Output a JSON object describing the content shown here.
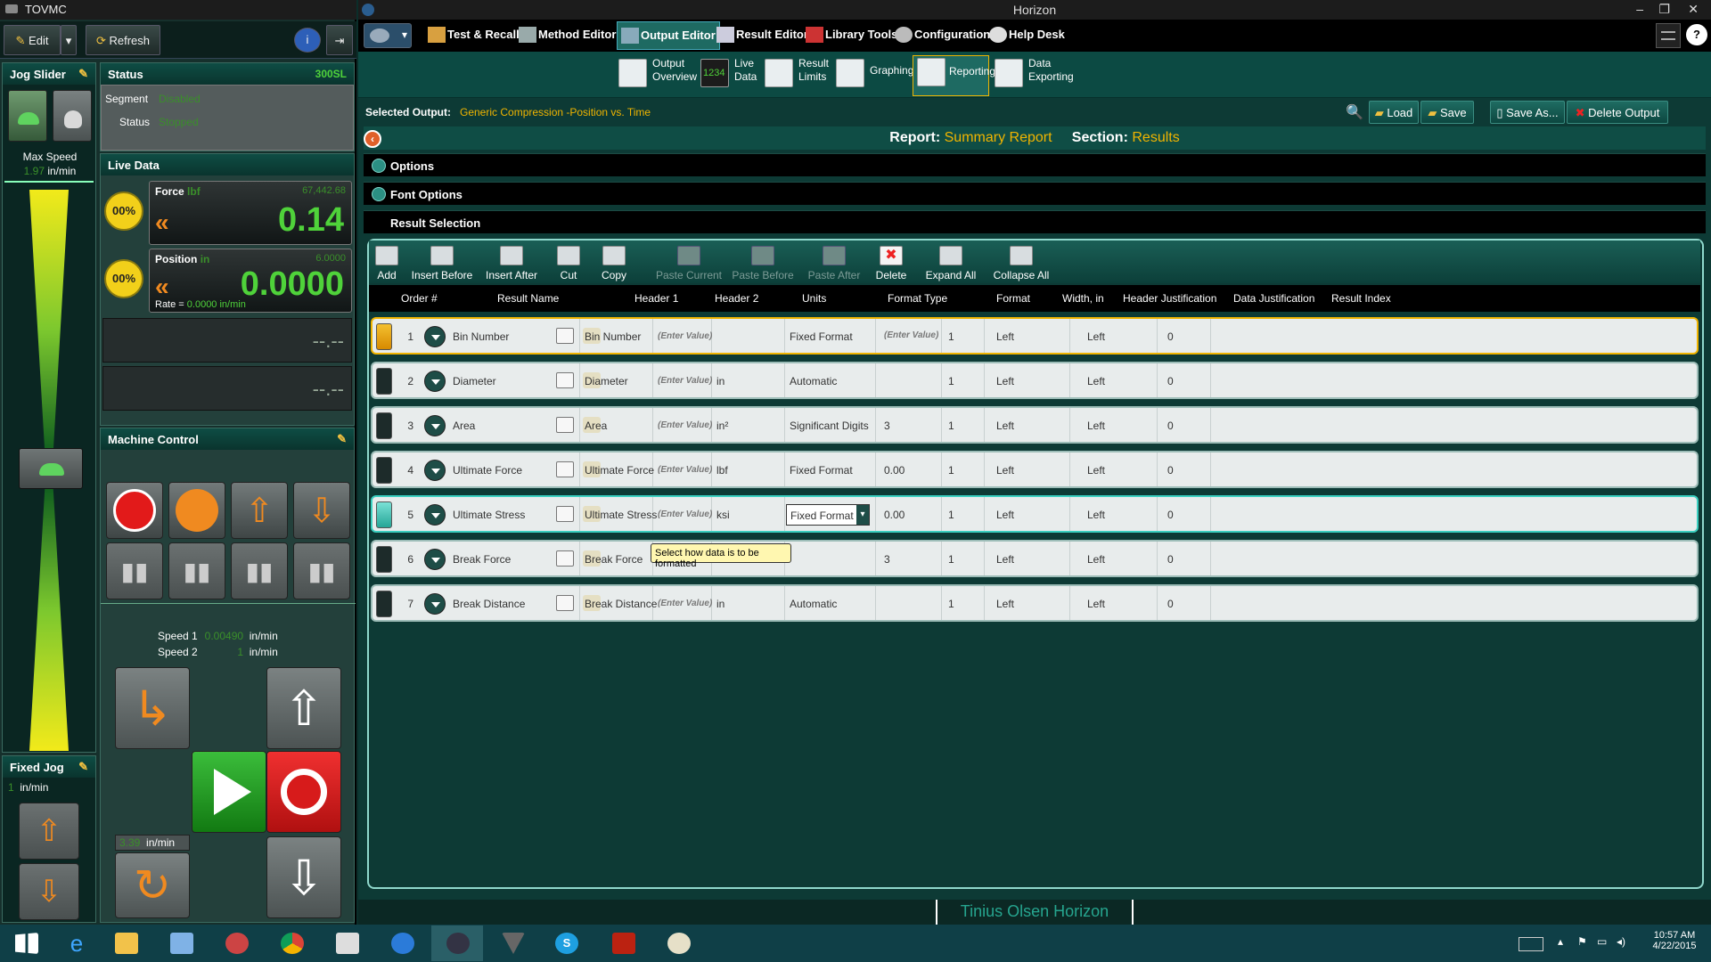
{
  "tovmc": {
    "title": "TOVMC",
    "toolbar": {
      "edit": "Edit",
      "refresh": "Refresh"
    },
    "jog_slider": {
      "title": "Jog Slider",
      "max_speed_label": "Max Speed",
      "max_speed_value": "1.97",
      "max_speed_unit": "in/min"
    },
    "status": {
      "title": "Status",
      "model": "300SL",
      "segment_label": "Segment",
      "segment_value": "Disabled",
      "status_label": "Status",
      "status_value": "Stopped"
    },
    "live_data": {
      "title": "Live Data",
      "force": {
        "label": "Force",
        "unit": "lbf",
        "capacity": "67,442.68",
        "value": "0.14",
        "tare": "00%"
      },
      "position": {
        "label": "Position",
        "unit": "in",
        "capacity": "6.0000",
        "value": "0.0000",
        "rate_label": "Rate =",
        "rate_value": "0.0000 in/min",
        "tare": "00%"
      },
      "empty1": "--.--",
      "empty2": "--.--"
    },
    "machine_control": {
      "title": "Machine Control",
      "speed1_label": "Speed 1",
      "speed1_value": "0.00490",
      "speed1_unit": "in/min",
      "speed2_label": "Speed 2",
      "speed2_value": "1",
      "speed2_unit": "in/min",
      "return_speed_value": "3.39",
      "return_speed_unit": "in/min"
    },
    "fixed_jog": {
      "title": "Fixed Jog",
      "value": "1",
      "unit": "in/min"
    }
  },
  "horizon": {
    "title": "Horizon",
    "menu": [
      "Test & Recall",
      "Method Editor",
      "Output Editor",
      "Result Editor",
      "Library Tools",
      "Configuration",
      "Help Desk"
    ],
    "subtabs": [
      {
        "label": "Output\nOverview"
      },
      {
        "label": "Live\nData"
      },
      {
        "label": "Result\nLimits"
      },
      {
        "label": "Graphing"
      },
      {
        "label": "Reporting"
      },
      {
        "label": "Data\nExporting"
      }
    ],
    "selected_output_label": "Selected Output:",
    "selected_output_value": "Generic Compression -Position vs. Time",
    "actions": {
      "load": "Load",
      "save": "Save",
      "save_as": "Save As...",
      "delete": "Delete Output"
    },
    "report_label": "Report:",
    "report_value": "Summary Report",
    "section_label": "Section:",
    "section_value": "Results",
    "options": "Options",
    "font_options": "Font Options",
    "result_selection": "Result Selection",
    "tools": [
      "Add",
      "Insert Before",
      "Insert After",
      "Cut",
      "Copy",
      "Paste Current",
      "Paste Before",
      "Paste After",
      "Delete",
      "Expand All",
      "Collapse All"
    ],
    "columns": [
      "Order #",
      "Result Name",
      "Header 1",
      "Header 2",
      "Units",
      "Format Type",
      "Format",
      "Width, in",
      "Header Justification",
      "Data Justification",
      "Result Index"
    ],
    "enter_value": "(Enter Value)",
    "rows": [
      {
        "order": "1",
        "name": "Bin Number",
        "header1": "Bin Number",
        "units": "",
        "format_type": "Fixed Format",
        "format": "(Enter Value)",
        "width": "1",
        "hjust": "Left",
        "djust": "Left",
        "index": "0"
      },
      {
        "order": "2",
        "name": "Diameter",
        "header1": "Diameter",
        "units": "in",
        "format_type": "Automatic",
        "format": "",
        "width": "1",
        "hjust": "Left",
        "djust": "Left",
        "index": "0"
      },
      {
        "order": "3",
        "name": "Area",
        "header1": "Area",
        "units": "in²",
        "format_type": "Significant Digits",
        "format": "3",
        "width": "1",
        "hjust": "Left",
        "djust": "Left",
        "index": "0"
      },
      {
        "order": "4",
        "name": "Ultimate Force",
        "header1": "Ultimate Force",
        "units": "lbf",
        "format_type": "Fixed Format",
        "format": "0.00",
        "width": "1",
        "hjust": "Left",
        "djust": "Left",
        "index": "0"
      },
      {
        "order": "5",
        "name": "Ultimate Stress",
        "header1": "Ultimate Stress",
        "units": "ksi",
        "format_type": "Fixed Format",
        "format": "0.00",
        "width": "1",
        "hjust": "Left",
        "djust": "Left",
        "index": "0"
      },
      {
        "order": "6",
        "name": "Break Force",
        "header1": "Break Force",
        "units": "lbf",
        "format_type": "",
        "format": "3",
        "width": "1",
        "hjust": "Left",
        "djust": "Left",
        "index": "0"
      },
      {
        "order": "7",
        "name": "Break Distance",
        "header1": "Break Distance",
        "units": "in",
        "format_type": "Automatic",
        "format": "",
        "width": "1",
        "hjust": "Left",
        "djust": "Left",
        "index": "0"
      }
    ],
    "tooltip": "Select how data is to be formatted",
    "status_text": "Tinius Olsen Horizon"
  },
  "taskbar": {
    "time": "10:57 AM",
    "date": "4/22/2015"
  },
  "colors": {
    "accent": "#0d3a35",
    "highlight": "#f0b400",
    "green_readout": "#4fd23a"
  }
}
